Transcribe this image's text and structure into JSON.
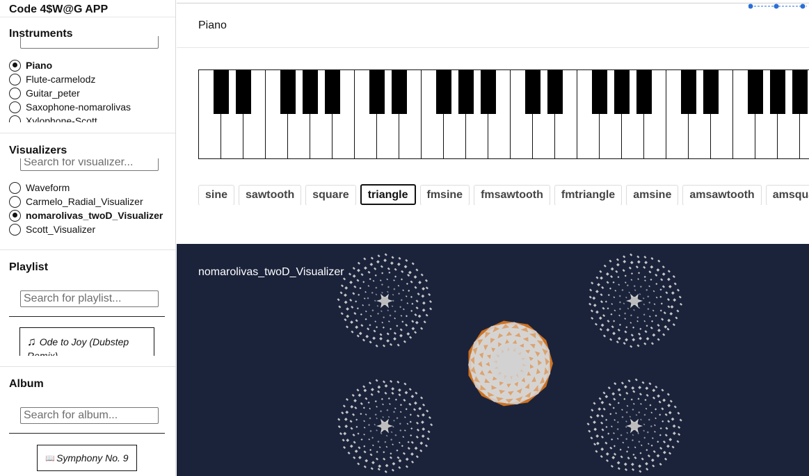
{
  "app": {
    "title": "Code 4$W@G APP"
  },
  "instruments": {
    "heading": "Instruments",
    "items": [
      {
        "label": "Piano",
        "selected": true
      },
      {
        "label": "Flute-carmelodz",
        "selected": false
      },
      {
        "label": "Guitar_peter",
        "selected": false
      },
      {
        "label": "Saxophone-nomarolivas",
        "selected": false
      },
      {
        "label": "Xylophone-Scott",
        "selected": false
      }
    ]
  },
  "visualizers": {
    "heading": "Visualizers",
    "search_placeholder": "Search for visualizer...",
    "items": [
      {
        "label": "Waveform",
        "selected": false
      },
      {
        "label": "Carmelo_Radial_Visualizer",
        "selected": false
      },
      {
        "label": "nomarolivas_twoD_Visualizer",
        "selected": true
      },
      {
        "label": "Scott_Visualizer",
        "selected": false
      }
    ]
  },
  "playlist": {
    "heading": "Playlist",
    "search_placeholder": "Search for playlist...",
    "song": {
      "icon": "music-note-icon",
      "title": "Ode to Joy (Dubstep Remix)"
    }
  },
  "album": {
    "heading": "Album",
    "search_placeholder": "Search for album...",
    "card": {
      "icon": "album-icon",
      "title": "Symphony No. 9"
    }
  },
  "main": {
    "instrument_name": "Piano",
    "waveforms": [
      "sine",
      "sawtooth",
      "square",
      "triangle",
      "fmsine",
      "fmsawtooth",
      "fmtriangle",
      "amsine",
      "amsawtooth",
      "amsquare"
    ],
    "active_waveform": "triangle",
    "visualizer_name": "nomarolivas_twoD_Visualizer"
  },
  "colors": {
    "viz_background": "#1b233b",
    "viz_dots": "#d8d8d8",
    "viz_accent": "#e07a1f",
    "selection_handle": "#2a6fd6"
  }
}
